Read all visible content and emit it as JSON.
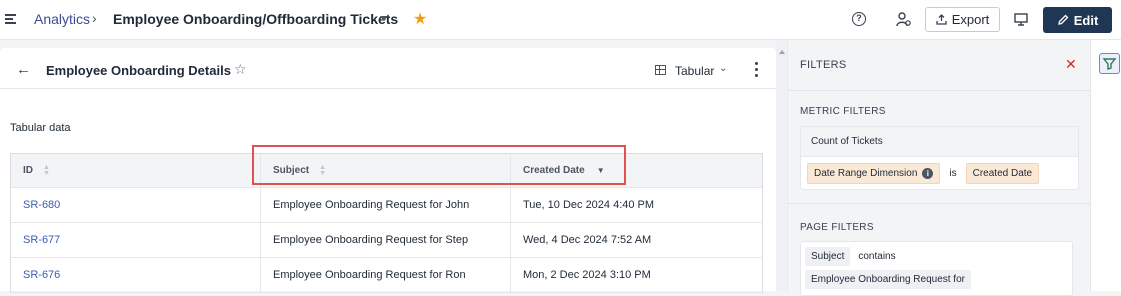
{
  "header": {
    "breadcrumb_root": "Analytics",
    "breadcrumb_sep": "›",
    "title": "Employee Onboarding/Offboarding Tickets",
    "export_label": "Export",
    "edit_label": "Edit",
    "help_glyph": "?"
  },
  "report": {
    "back_glyph": "←",
    "title": "Employee Onboarding Details",
    "star_glyph": "☆",
    "view_label": "Tabular",
    "view_caret": "⌄",
    "section_label": "Tabular data"
  },
  "table": {
    "columns": [
      "ID",
      "Subject",
      "Created Date"
    ],
    "rows": [
      [
        "SR-680",
        "Employee Onboarding Request for John",
        "Tue, 10 Dec 2024 4:40 PM"
      ],
      [
        "SR-677",
        "Employee Onboarding Request for Step",
        "Wed, 4 Dec 2024 7:52 AM"
      ],
      [
        "SR-676",
        "Employee Onboarding Request for Ron",
        "Mon, 2 Dec 2024 3:10 PM"
      ]
    ]
  },
  "filters": {
    "title": "FILTERS",
    "close_glyph": "✕",
    "metric_section": "METRIC FILTERS",
    "metric_name": "Count of Tickets",
    "metric_dimension": "Date Range Dimension",
    "metric_operator": "is",
    "metric_value": "Created Date",
    "page_section": "PAGE FILTERS",
    "page_field": "Subject",
    "page_operator": "contains",
    "page_value": "Employee Onboarding Request for"
  },
  "colors": {
    "accent": "#1f3655",
    "link": "#3b5bb5",
    "highlight": "#e05252",
    "star": "#f59e0b"
  }
}
